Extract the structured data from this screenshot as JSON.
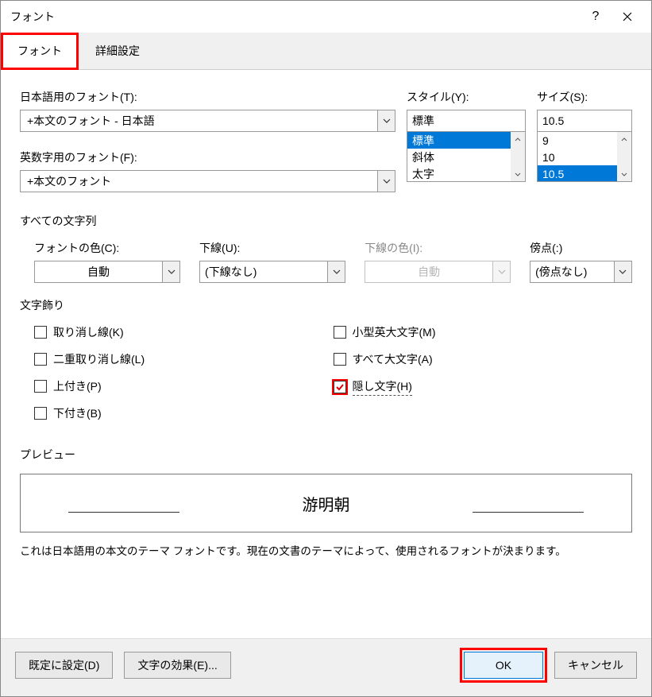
{
  "title": "フォント",
  "tabs": {
    "font": "フォント",
    "advanced": "詳細設定"
  },
  "labels": {
    "jpFont": "日本語用のフォント(T):",
    "enFont": "英数字用のフォント(F):",
    "style": "スタイル(Y):",
    "size": "サイズ(S):",
    "allText": "すべての文字列",
    "fontColor": "フォントの色(C):",
    "underline": "下線(U):",
    "underlineColor": "下線の色(I):",
    "emphasis": "傍点(:)",
    "decoration": "文字飾り",
    "preview": "プレビュー"
  },
  "values": {
    "jpFont": "+本文のフォント - 日本語",
    "enFont": "+本文のフォント",
    "style": "標準",
    "size": "10.5",
    "fontColor": "自動",
    "underline": "(下線なし)",
    "underlineColor": "自動",
    "emphasis": "(傍点なし)"
  },
  "styleOptions": [
    "標準",
    "斜体",
    "太字"
  ],
  "sizeOptions": [
    "9",
    "10",
    "10.5"
  ],
  "checks": {
    "strikethrough": "取り消し線(K)",
    "doubleStrike": "二重取り消し線(L)",
    "superscript": "上付き(P)",
    "subscript": "下付き(B)",
    "smallCaps": "小型英大文字(M)",
    "allCaps": "すべて大文字(A)",
    "hidden": "隠し文字(H)"
  },
  "previewText": "游明朝",
  "descText": "これは日本語用の本文のテーマ フォントです。現在の文書のテーマによって、使用されるフォントが決まります。",
  "buttons": {
    "setDefault": "既定に設定(D)",
    "textEffects": "文字の効果(E)...",
    "ok": "OK",
    "cancel": "キャンセル"
  },
  "help": "?"
}
